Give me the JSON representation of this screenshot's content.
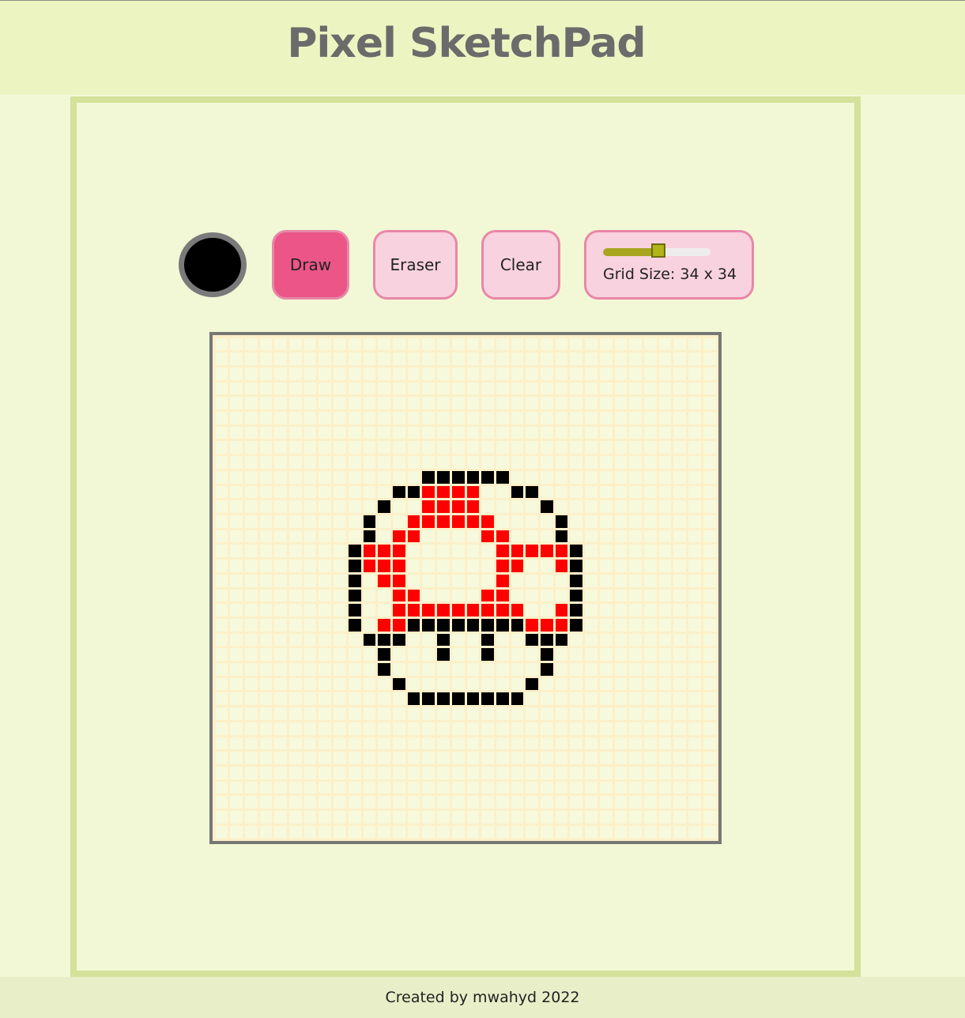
{
  "header": {
    "title": "Pixel SketchPad"
  },
  "toolbar": {
    "color": "#000000",
    "draw_label": "Draw",
    "eraser_label": "Eraser",
    "clear_label": "Clear",
    "active_mode": "Draw",
    "grid_size": 34,
    "grid_min": 2,
    "grid_max": 64,
    "grid_size_label": "Grid Size: 34 x 34"
  },
  "canvas": {
    "rows": 34,
    "cols": 34,
    "empty_color": "#f7f9dc",
    "line_color": "#fbf0c9",
    "colors": {
      "black": "#000000",
      "red": "#ff0000"
    },
    "pixels": {
      "black": [
        [
          9,
          14
        ],
        [
          9,
          15
        ],
        [
          9,
          16
        ],
        [
          9,
          17
        ],
        [
          9,
          18
        ],
        [
          9,
          19
        ],
        [
          10,
          12
        ],
        [
          10,
          13
        ],
        [
          10,
          20
        ],
        [
          10,
          21
        ],
        [
          11,
          11
        ],
        [
          11,
          22
        ],
        [
          12,
          10
        ],
        [
          12,
          23
        ],
        [
          13,
          10
        ],
        [
          13,
          23
        ],
        [
          14,
          9
        ],
        [
          14,
          24
        ],
        [
          15,
          9
        ],
        [
          15,
          24
        ],
        [
          16,
          9
        ],
        [
          16,
          24
        ],
        [
          17,
          9
        ],
        [
          17,
          24
        ],
        [
          18,
          9
        ],
        [
          18,
          24
        ],
        [
          19,
          9
        ],
        [
          19,
          13
        ],
        [
          19,
          14
        ],
        [
          19,
          15
        ],
        [
          19,
          16
        ],
        [
          19,
          17
        ],
        [
          19,
          18
        ],
        [
          19,
          19
        ],
        [
          19,
          20
        ],
        [
          19,
          24
        ],
        [
          20,
          10
        ],
        [
          20,
          11
        ],
        [
          20,
          12
        ],
        [
          20,
          15
        ],
        [
          20,
          18
        ],
        [
          20,
          21
        ],
        [
          20,
          22
        ],
        [
          20,
          23
        ],
        [
          21,
          11
        ],
        [
          21,
          15
        ],
        [
          21,
          18
        ],
        [
          21,
          22
        ],
        [
          22,
          11
        ],
        [
          22,
          22
        ],
        [
          23,
          12
        ],
        [
          23,
          21
        ],
        [
          24,
          13
        ],
        [
          24,
          14
        ],
        [
          24,
          15
        ],
        [
          24,
          16
        ],
        [
          24,
          17
        ],
        [
          24,
          18
        ],
        [
          24,
          19
        ],
        [
          24,
          20
        ]
      ],
      "red": [
        [
          10,
          14
        ],
        [
          10,
          15
        ],
        [
          10,
          16
        ],
        [
          10,
          17
        ],
        [
          11,
          14
        ],
        [
          11,
          15
        ],
        [
          11,
          16
        ],
        [
          11,
          17
        ],
        [
          12,
          13
        ],
        [
          12,
          14
        ],
        [
          12,
          15
        ],
        [
          12,
          16
        ],
        [
          12,
          17
        ],
        [
          12,
          18
        ],
        [
          13,
          12
        ],
        [
          13,
          13
        ],
        [
          13,
          18
        ],
        [
          13,
          19
        ],
        [
          14,
          10
        ],
        [
          14,
          11
        ],
        [
          14,
          12
        ],
        [
          14,
          19
        ],
        [
          14,
          20
        ],
        [
          14,
          21
        ],
        [
          14,
          22
        ],
        [
          14,
          23
        ],
        [
          15,
          10
        ],
        [
          15,
          11
        ],
        [
          15,
          12
        ],
        [
          15,
          19
        ],
        [
          15,
          20
        ],
        [
          15,
          23
        ],
        [
          16,
          11
        ],
        [
          16,
          12
        ],
        [
          16,
          19
        ],
        [
          17,
          12
        ],
        [
          17,
          13
        ],
        [
          17,
          18
        ],
        [
          17,
          19
        ],
        [
          18,
          12
        ],
        [
          18,
          13
        ],
        [
          18,
          14
        ],
        [
          18,
          15
        ],
        [
          18,
          16
        ],
        [
          18,
          17
        ],
        [
          18,
          18
        ],
        [
          18,
          19
        ],
        [
          18,
          20
        ],
        [
          18,
          23
        ],
        [
          19,
          11
        ],
        [
          19,
          12
        ],
        [
          19,
          21
        ],
        [
          19,
          22
        ],
        [
          19,
          23
        ]
      ]
    }
  },
  "footer": {
    "text": "Created by mwahyd 2022"
  }
}
